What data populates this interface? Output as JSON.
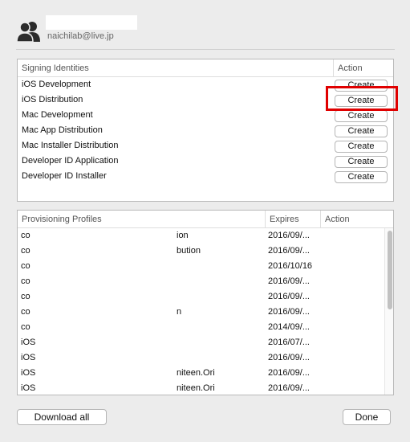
{
  "account": {
    "email": "naichilab@live.jp",
    "avatar_icon": "people-icon"
  },
  "signing": {
    "headers": {
      "name": "Signing Identities",
      "action": "Action"
    },
    "items": [
      {
        "label": "iOS Development",
        "button": "Create"
      },
      {
        "label": "iOS Distribution",
        "button": "Create"
      },
      {
        "label": "Mac Development",
        "button": "Create"
      },
      {
        "label": "Mac App Distribution",
        "button": "Create"
      },
      {
        "label": "Mac Installer Distribution",
        "button": "Create"
      },
      {
        "label": "Developer ID Application",
        "button": "Create"
      },
      {
        "label": "Developer ID Installer",
        "button": "Create"
      }
    ],
    "highlight_color": "#e00000"
  },
  "provisioning": {
    "headers": {
      "name": "Provisioning Profiles",
      "expires": "Expires",
      "action": "Action"
    },
    "rows": [
      {
        "name": "co",
        "name_tail": "ion",
        "expires": "2016/09/..."
      },
      {
        "name": "co",
        "name_tail": "bution",
        "expires": "2016/09/..."
      },
      {
        "name": "co",
        "name_tail": "",
        "expires": "2016/10/16"
      },
      {
        "name": "co",
        "name_tail": "",
        "expires": "2016/09/..."
      },
      {
        "name": "co",
        "name_tail": "",
        "expires": "2016/09/..."
      },
      {
        "name": "co",
        "name_tail": "n",
        "expires": "2016/09/..."
      },
      {
        "name": "co",
        "name_tail": "",
        "expires": "2014/09/..."
      },
      {
        "name": "iOS",
        "name_tail": "",
        "expires": "2016/07/..."
      },
      {
        "name": "iOS",
        "name_tail": "",
        "expires": "2016/09/..."
      },
      {
        "name": "iOS",
        "name_tail": "niteen.Ori",
        "expires": "2016/09/..."
      },
      {
        "name": "iOS",
        "name_tail": "niteen.Ori",
        "expires": "2016/09/..."
      }
    ]
  },
  "footer": {
    "download_all": "Download all",
    "done": "Done"
  }
}
